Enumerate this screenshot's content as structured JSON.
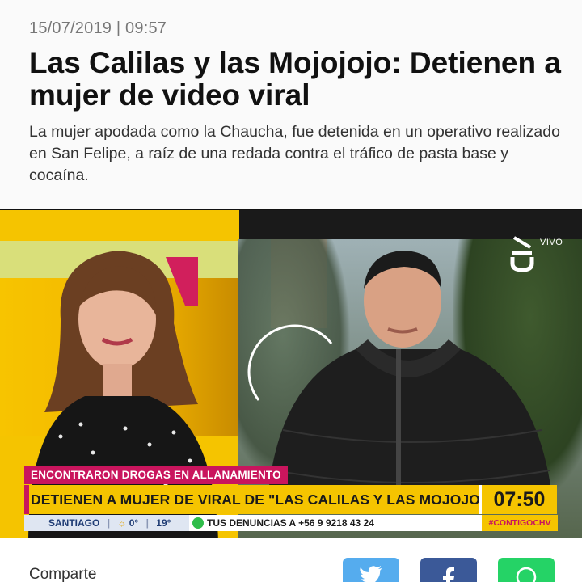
{
  "article": {
    "date": "15/07/2019",
    "separator": "|",
    "time": "09:57",
    "headline": "Las Calilas y las Mojojojo: Detienen a mujer de video viral",
    "lede": "La mujer apodada como la Chaucha, fue detenida en un operativo realizado en San Felipe, a raíz de una redada contra el tráfico de pasta base y cocaína."
  },
  "video": {
    "live_label": "VIVO",
    "kicker": "ENCONTRARON DROGAS EN ALLANAMIENTO",
    "main_caption": "DETIENEN A MUJER DE VIRAL DE \"LAS CALILAS Y LAS MOJOJOJO\"",
    "clock": "07:50",
    "weather_city": "SANTIAGO",
    "weather_low": "0°",
    "weather_high": "19°",
    "hotline": "TUS DENUNCIAS A +56 9 9218 43 24",
    "hashtag": "#CONTIGOCHV"
  },
  "share": {
    "label": "Comparte",
    "buttons": [
      {
        "network": "twitter",
        "icon": "twitter-icon",
        "color": "#55acee"
      },
      {
        "network": "facebook",
        "icon": "facebook-icon",
        "color": "#3b5998"
      },
      {
        "network": "whatsapp",
        "icon": "whatsapp-icon",
        "color": "#25d366"
      }
    ]
  },
  "colors": {
    "accent_yellow": "#f5c400",
    "accent_magenta": "#c9155d"
  }
}
